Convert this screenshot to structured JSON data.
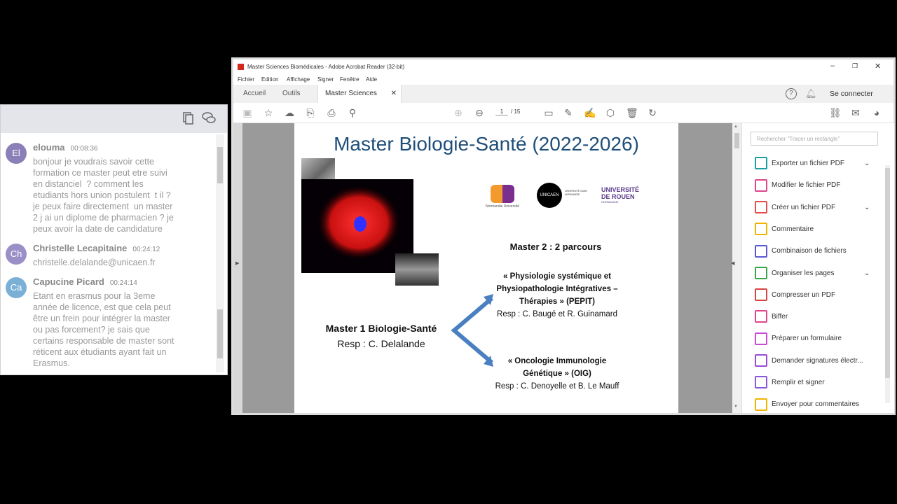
{
  "chat": {
    "messages": [
      {
        "initials": "El",
        "name": "elouma",
        "time": "00:08:36",
        "color": "#8b7fb8",
        "text": "bonjour je voudrais savoir cette\nformation ce master peut etre suivi\nen distanciel  ? comment les\netudiants hors union postulent  t il ?\nje peux faire directement  un master\n2 j ai un diplome de pharmacien ? je\npeux avoir la date de candidature"
      },
      {
        "initials": "Ch",
        "name": "Christelle Lecapitaine",
        "time": "00:24:12",
        "color": "#9a8fc7",
        "text": "christelle.delalande@unicaen.fr"
      },
      {
        "initials": "Ca",
        "name": "Capucine Picard",
        "time": "00:24:14",
        "color": "#7bb0d6",
        "text": "Etant en erasmus pour la 3eme\nannée de licence, est que cela peut\nêtre un frein pour intégrer la master\nou pas forcement? je sais que\ncertains responsable de master sont\nréticent aux étudiants ayant fait un\nErasmus."
      }
    ]
  },
  "acrobat": {
    "title": "Master Sciences Biomédicales - Adobe Acrobat Reader (32-bit)",
    "menu": [
      "Fichier",
      "Edition",
      "Affichage",
      "Signer",
      "Fenêtre",
      "Aide"
    ],
    "tabs": {
      "home": "Accueil",
      "tools": "Outils",
      "doc": "Master Sciences Bio..."
    },
    "sign_in": "Se connecter",
    "page_current": "1",
    "page_total": "/ 15",
    "search_placeholder": "Rechercher \"Tracer un rectangle\"",
    "tools": [
      {
        "label": "Exporter un fichier PDF",
        "color": "#1aa1a1",
        "chev": true
      },
      {
        "label": "Modifier le fichier PDF",
        "color": "#e0468c",
        "chev": false
      },
      {
        "label": "Créer un fichier PDF",
        "color": "#e64e4e",
        "chev": true
      },
      {
        "label": "Commentaire",
        "color": "#f0b400",
        "chev": false
      },
      {
        "label": "Combinaison de fichiers",
        "color": "#5a5ad6",
        "chev": false
      },
      {
        "label": "Organiser les pages",
        "color": "#3aa54a",
        "chev": true
      },
      {
        "label": "Compresser un PDF",
        "color": "#d6453f",
        "chev": false
      },
      {
        "label": "Biffer",
        "color": "#e0468c",
        "chev": false
      },
      {
        "label": "Préparer un formulaire",
        "color": "#c84bd6",
        "chev": false
      },
      {
        "label": "Demander signatures électr...",
        "color": "#9a4bd6",
        "chev": false
      },
      {
        "label": "Remplir et signer",
        "color": "#8a58d8",
        "chev": false
      },
      {
        "label": "Envoyer pour commentaires",
        "color": "#f0b400",
        "chev": false
      }
    ]
  },
  "slide": {
    "title": "Master Biologie-Santé (2022-2026)",
    "m2_heading": "Master 2 : 2 parcours",
    "p1_line1": "« Physiologie systémique et",
    "p1_line2": "Physiopathologie Intégratives –",
    "p1_line3": "Thérapies » (PEPIT)",
    "p1_resp": "Resp : C. Baugé et R. Guinamard",
    "m1_heading": "Master 1 Biologie-Santé",
    "m1_resp": "Resp : C. Delalande",
    "p2_line1": "« Oncologie Immunologie",
    "p2_line2": "Génétique » (OIG)",
    "p2_resp": "Resp : C. Denoyelle et B. Le Mauff",
    "logo_normandie": "Normandie Université",
    "logo_unicaen": "UNICAEN",
    "logo_unicaen_sub": "UNIVERSITÉ CAEN NORMANDIE",
    "logo_rouen1": "UNIVERSITÉ",
    "logo_rouen2": "DE ROUEN",
    "logo_rouen3": "NORMANDIE"
  }
}
